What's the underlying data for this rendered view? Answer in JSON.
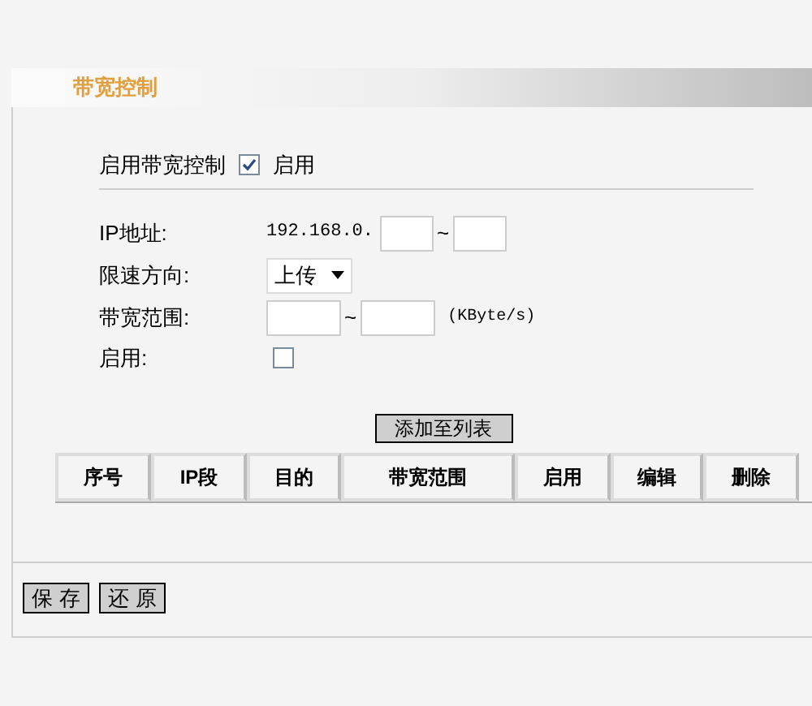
{
  "section_title": "带宽控制",
  "master": {
    "label": "启用带宽控制",
    "checked": true,
    "option": "启用"
  },
  "form": {
    "ip_label": "IP地址:",
    "ip_prefix": "192.168.0.",
    "ip_sep": "~",
    "direction_label": "限速方向:",
    "direction_value": "上传",
    "range_label": "带宽范围:",
    "range_sep": "~",
    "range_unit": "(KByte/s)",
    "enable_label": "启用:",
    "enable_checked": false
  },
  "add_button": "添加至列表",
  "table": {
    "columns": [
      "序号",
      "IP段",
      "目的",
      "带宽范围",
      "启用",
      "编辑",
      "删除"
    ]
  },
  "buttons": [
    "保 存",
    "还 原"
  ]
}
